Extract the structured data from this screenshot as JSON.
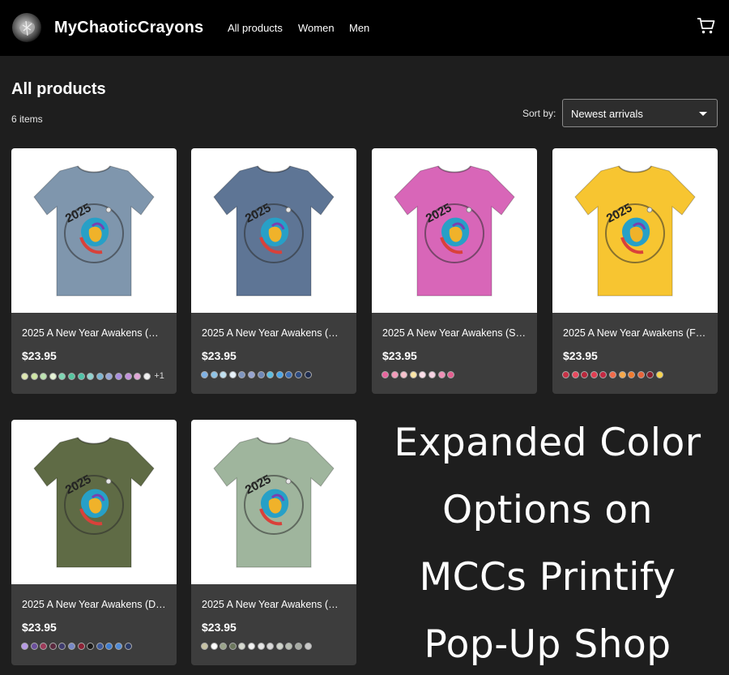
{
  "header": {
    "brand": "MyChaoticCrayons",
    "nav": [
      "All products",
      "Women",
      "Men"
    ],
    "cart_icon": "cart-icon"
  },
  "listing": {
    "title": "All products",
    "count": "6 items",
    "sort_label": "Sort by:",
    "sort_value": "Newest arrivals"
  },
  "products": [
    {
      "title": "2025 A New Year Awakens (…",
      "price": "$23.95",
      "shirt_color": "#7f96ad",
      "more": "+1",
      "swatches": [
        "#dfe8b0",
        "#cfe6a3",
        "#bde3b0",
        "#e6f3d5",
        "#7fd6b4",
        "#56c6a0",
        "#4fc4a9",
        "#8fd3cf",
        "#7bb5d2",
        "#96a6d6",
        "#a98ee0",
        "#c391dd",
        "#e2a6d6",
        "#f1f1f1"
      ]
    },
    {
      "title": "2025 A New Year Awakens (…",
      "price": "$23.95",
      "shirt_color": "#5e7595",
      "more": "",
      "swatches": [
        "#7fb2e5",
        "#8ec3e6",
        "#bfe0f0",
        "#e8f2fa",
        "#7f96c0",
        "#96a4d2",
        "#6f88b8",
        "#5abde0",
        "#49a6e8",
        "#3b6fb8",
        "#2c4a80",
        "#1e2c4f"
      ]
    },
    {
      "title": "2025 A New Year Awakens (S…",
      "price": "$23.95",
      "shirt_color": "#d866b8",
      "more": "",
      "swatches": [
        "#e7659d",
        "#f49ab9",
        "#f7c1cc",
        "#fbe6a6",
        "#fde0ea",
        "#f7d2e3",
        "#f08fb6",
        "#e45e8f"
      ]
    },
    {
      "title": "2025 A New Year Awakens (F…",
      "price": "$23.95",
      "shirt_color": "#f7c531",
      "more": "",
      "swatches": [
        "#c73246",
        "#e84a5f",
        "#b8283c",
        "#e03e52",
        "#c42942",
        "#f16b4a",
        "#f6a84a",
        "#f07a2e",
        "#e8643a",
        "#8a1f2c",
        "#f7d44c"
      ]
    },
    {
      "title": "2025 A New Year Awakens (D…",
      "price": "$23.95",
      "shirt_color": "#5f6b45",
      "more": "",
      "swatches": [
        "#b79ae6",
        "#6b4f9c",
        "#9c3a59",
        "#5b2a3f",
        "#3f3c6e",
        "#7788c6",
        "#8c2236",
        "#1b1b1b",
        "#3e5a9a",
        "#3d7ccf",
        "#4f8ad6",
        "#2a3a66"
      ]
    },
    {
      "title": "2025 A New Year Awakens (…",
      "price": "$23.95",
      "shirt_color": "#9fb59d",
      "more": "",
      "swatches": [
        "#c7c2a3",
        "#ffffff",
        "#9aa38a",
        "#6c775d",
        "#d6d9cf",
        "#f2f2f2",
        "#e6e6e6",
        "#d9d9d9",
        "#cfd4cb",
        "#b9bfb4",
        "#a6aba3",
        "#c9c9c9"
      ]
    }
  ],
  "promo_lines": [
    "Expanded Color",
    "Options on",
    "MCCs Printify",
    "Pop-Up Shop"
  ]
}
